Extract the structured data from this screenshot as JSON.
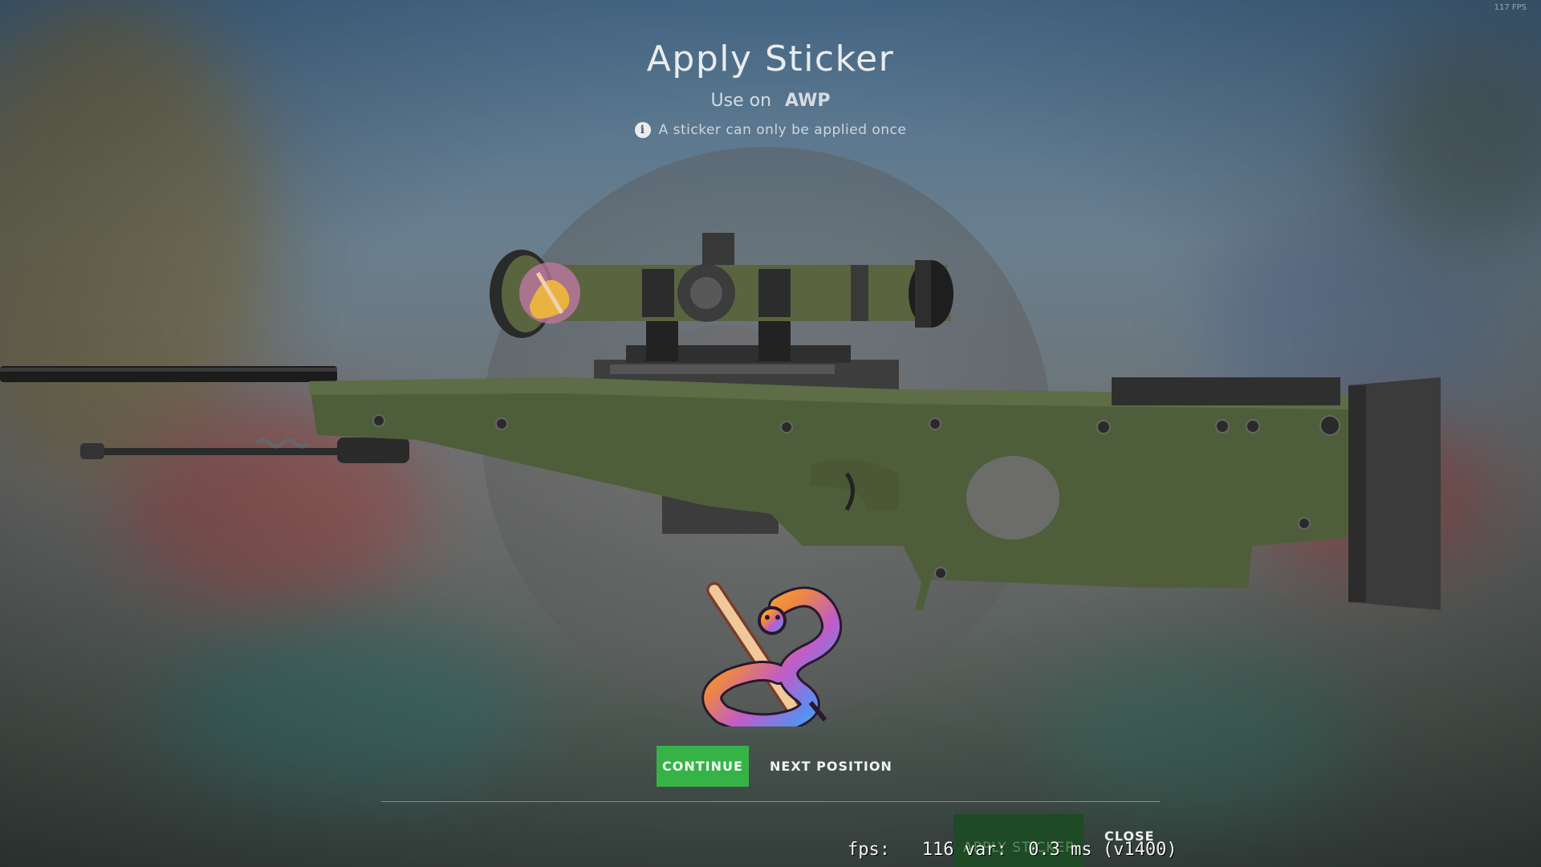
{
  "header": {
    "title": "Apply Sticker",
    "use_on_label": "Use on",
    "weapon_name": "AWP",
    "notice": "A sticker can only be applied once",
    "notice_icon": "info-icon"
  },
  "fps_corner": "117 FPS",
  "actions": {
    "continue_label": "CONTINUE",
    "next_position_label": "NEXT POSITION",
    "apply_sticker_label": "APPLY STICKER",
    "close_label": "CLOSE"
  },
  "fps_overlay": {
    "text": "fps:   116 var:  0.3 ms (v1400)"
  },
  "colors": {
    "continue": "#36b347",
    "apply_disabled": "#1f4a26",
    "rifle_green": "#4f5e3a"
  }
}
